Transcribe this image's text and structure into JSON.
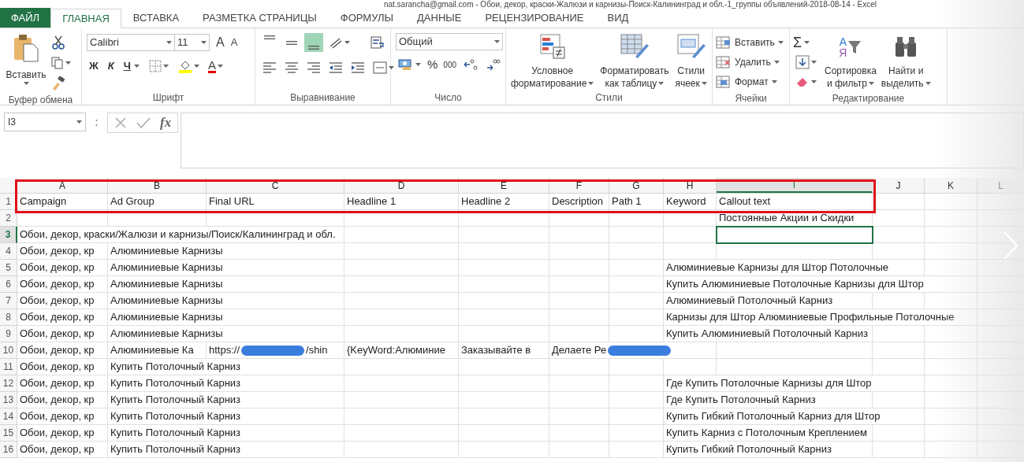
{
  "title": "nat.sarancha@gmail.com - Обои, декор, краски-Жалюзи и карнизы-Поиск-Калининград и обл.-1_группы объявлений-2018-08-14 - Excel",
  "tabs": [
    {
      "label": "ФАЙЛ",
      "kind": "file",
      "selected": false
    },
    {
      "label": "ГЛАВНАЯ",
      "kind": "tab",
      "selected": true
    },
    {
      "label": "ВСТАВКА",
      "kind": "tab",
      "selected": false
    },
    {
      "label": "РАЗМЕТКА СТРАНИЦЫ",
      "kind": "tab",
      "selected": false
    },
    {
      "label": "ФОРМУЛЫ",
      "kind": "tab",
      "selected": false
    },
    {
      "label": "ДАННЫЕ",
      "kind": "tab",
      "selected": false
    },
    {
      "label": "РЕЦЕНЗИРОВАНИЕ",
      "kind": "tab",
      "selected": false
    },
    {
      "label": "ВИД",
      "kind": "tab",
      "selected": false
    }
  ],
  "ribbon": {
    "clipboard": {
      "paste": "Вставить",
      "label": "Буфер обмена"
    },
    "font": {
      "family": "Calibri",
      "size": "11",
      "grow": "A",
      "shrink": "A",
      "bold": "Ж",
      "italic": "К",
      "underline": "Ч",
      "font_color": "A",
      "label": "Шрифт"
    },
    "alignment": {
      "vertical": [
        {
          "kind": "top",
          "on": false
        },
        {
          "kind": "middle",
          "on": false
        },
        {
          "kind": "bottom",
          "on": true
        }
      ],
      "label": "Выравнивание"
    },
    "number": {
      "format": "Общий",
      "percent": "%",
      "thousands": "000",
      "label": "Число"
    },
    "styles": {
      "buttons": [
        {
          "kind": "conditional",
          "lines": [
            "Условное",
            "форматирование"
          ]
        },
        {
          "kind": "table",
          "lines": [
            "Форматировать",
            "как таблицу"
          ]
        },
        {
          "kind": "cellstyle",
          "lines": [
            "Стили",
            "ячеек"
          ]
        }
      ],
      "label": "Стили"
    },
    "cells": {
      "buttons": [
        {
          "kind": "insert",
          "label": "Вставить"
        },
        {
          "kind": "delete",
          "label": "Удалить"
        },
        {
          "kind": "format",
          "label": "Формат"
        }
      ],
      "label": "Ячейки"
    },
    "editing": {
      "sum": "Σ",
      "sort_letters": [
        "А",
        "Я"
      ],
      "buttons": [
        {
          "kind": "sort",
          "lines": [
            "Сортировка",
            "и фильтр"
          ]
        },
        {
          "kind": "find",
          "lines": [
            "Найти и",
            "выделить"
          ]
        }
      ],
      "label": "Редактирование"
    }
  },
  "formula_bar": {
    "name_box": "I3",
    "function_button": "fx"
  },
  "columns": [
    {
      "label": "A",
      "selected": false
    },
    {
      "label": "B",
      "selected": false
    },
    {
      "label": "C",
      "selected": false
    },
    {
      "label": "D",
      "selected": false
    },
    {
      "label": "E",
      "selected": false
    },
    {
      "label": "F",
      "selected": false
    },
    {
      "label": "G",
      "selected": false
    },
    {
      "label": "H",
      "selected": false
    },
    {
      "label": "I",
      "selected": true
    },
    {
      "label": "J",
      "selected": false
    },
    {
      "label": "K",
      "selected": false
    },
    {
      "label": "L",
      "selected": false
    }
  ],
  "rows": [
    {
      "number": "1",
      "selected": false,
      "cells": [
        {
          "text": "Campaign"
        },
        {
          "text": "Ad Group"
        },
        {
          "text": "Final URL"
        },
        {
          "text": "Headline 1"
        },
        {
          "text": "Headline 2"
        },
        {
          "text": "Description"
        },
        {
          "text": "Path 1"
        },
        {
          "text": "Keyword"
        },
        {
          "text": "Callout text"
        }
      ]
    },
    {
      "number": "2",
      "selected": false,
      "cells": [
        null,
        null,
        null,
        null,
        null,
        null,
        null,
        null,
        {
          "text": "Постоянные Акции и Скидки"
        }
      ]
    },
    {
      "number": "3",
      "selected": true,
      "cells": [
        {
          "text": "Обои, декор, краски/Жалюзи и карнизы/Поиск/Калининград и обл."
        }
      ]
    },
    {
      "number": "4",
      "selected": false,
      "cells": [
        {
          "text": "Обои, декор, кр"
        },
        {
          "text": "Алюминиевые Карнизы"
        }
      ]
    },
    {
      "number": "5",
      "selected": false,
      "cells": [
        {
          "text": "Обои, декор, кр"
        },
        {
          "text": "Алюминиевые Карнизы"
        },
        null,
        null,
        null,
        null,
        null,
        {
          "text": "Алюминиевые Карнизы для Штор Потолочные"
        }
      ]
    },
    {
      "number": "6",
      "selected": false,
      "cells": [
        {
          "text": "Обои, декор, кр"
        },
        {
          "text": "Алюминиевые Карнизы"
        },
        null,
        null,
        null,
        null,
        null,
        {
          "text": "Купить Алюминиевые Потолочные Карнизы для Штор"
        }
      ]
    },
    {
      "number": "7",
      "selected": false,
      "cells": [
        {
          "text": "Обои, декор, кр"
        },
        {
          "text": "Алюминиевые Карнизы"
        },
        null,
        null,
        null,
        null,
        null,
        {
          "text": "Алюминиевый Потолочный Карниз"
        }
      ]
    },
    {
      "number": "8",
      "selected": false,
      "cells": [
        {
          "text": "Обои, декор, кр"
        },
        {
          "text": "Алюминиевые Карнизы"
        },
        null,
        null,
        null,
        null,
        null,
        {
          "text": "Карнизы для Штор Алюминиевые Профильные Потолочные"
        }
      ]
    },
    {
      "number": "9",
      "selected": false,
      "cells": [
        {
          "text": "Обои, декор, кр"
        },
        {
          "text": "Алюминиевые Карнизы"
        },
        null,
        null,
        null,
        null,
        null,
        {
          "text": "Купить Алюминиевый Потолочный Карниз"
        }
      ]
    },
    {
      "number": "10",
      "selected": false,
      "cells": [
        {
          "text": "Обои, декор, кр"
        },
        {
          "text": "Алюминиевые Ка"
        },
        {
          "text": "https://",
          "redacted": true,
          "text_after": "/shin"
        },
        {
          "text": "{KeyWord:Алюминие"
        },
        {
          "text": "Заказывайте в"
        },
        {
          "text": "Делаете Ре",
          "redacted": true
        }
      ]
    },
    {
      "number": "11",
      "selected": false,
      "cells": [
        {
          "text": "Обои, декор, кр"
        },
        {
          "text": "Купить Потолочный Карниз"
        }
      ]
    },
    {
      "number": "12",
      "selected": false,
      "cells": [
        {
          "text": "Обои, декор, кр"
        },
        {
          "text": "Купить Потолочный Карниз"
        },
        null,
        null,
        null,
        null,
        null,
        {
          "text": "Где Купить Потолочные Карнизы для Штор"
        }
      ]
    },
    {
      "number": "13",
      "selected": false,
      "cells": [
        {
          "text": "Обои, декор, кр"
        },
        {
          "text": "Купить Потолочный Карниз"
        },
        null,
        null,
        null,
        null,
        null,
        {
          "text": "Где Купить Потолочный Карниз"
        }
      ]
    },
    {
      "number": "14",
      "selected": false,
      "cells": [
        {
          "text": "Обои, декор, кр"
        },
        {
          "text": "Купить Потолочный Карниз"
        },
        null,
        null,
        null,
        null,
        null,
        {
          "text": "Купить Гибкий Потолочный Карниз для Штор"
        }
      ]
    },
    {
      "number": "15",
      "selected": false,
      "cells": [
        {
          "text": "Обои, декор, кр"
        },
        {
          "text": "Купить Потолочный Карниз"
        },
        null,
        null,
        null,
        null,
        null,
        {
          "text": "Купить Карниз с Потолочным Креплением"
        }
      ]
    },
    {
      "number": "16",
      "selected": false,
      "cells": [
        {
          "text": "Обои, декор, кр"
        },
        {
          "text": "Купить Потолочный Карниз"
        },
        null,
        null,
        null,
        null,
        null,
        {
          "text": "Купить Гибкий Потолочный Карниз"
        }
      ]
    }
  ]
}
